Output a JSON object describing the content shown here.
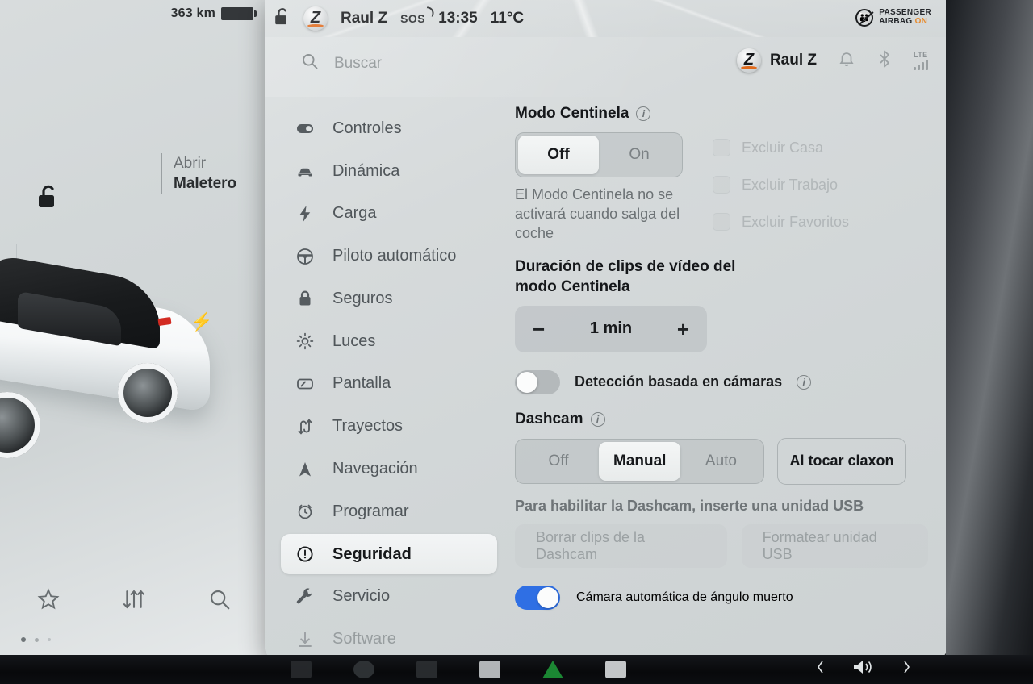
{
  "car_panel": {
    "range": "363 km",
    "battery_icon": "battery-icon",
    "lock_icon": "unlock-icon",
    "trunk_callout": {
      "action": "Abrir",
      "target": "Maletero"
    },
    "toolbar": [
      {
        "name": "favorites-icon",
        "glyph": "star"
      },
      {
        "name": "sliders-icon",
        "glyph": "sliders"
      },
      {
        "name": "search-icon",
        "glyph": "magnifier"
      }
    ]
  },
  "status_strip": {
    "lock_icon": "unlock-icon",
    "profile_name": "Raul Z",
    "sos_label": "SOS",
    "clock": "13:35",
    "temperature": "11°C",
    "airbag": {
      "line1": "PASSENGER",
      "line2": "AIRBAG",
      "state": "ON",
      "state_color": "#e8892a"
    }
  },
  "header": {
    "search_placeholder": "Buscar",
    "profile_name": "Raul Z",
    "icons": [
      "bell-icon",
      "bluetooth-icon",
      "lte-signal-icon"
    ],
    "network_label": "LTE"
  },
  "sidebar": {
    "items": [
      {
        "label": "Controles",
        "icon": "toggle-icon",
        "active": false,
        "dim": false
      },
      {
        "label": "Dinámica",
        "icon": "car-icon",
        "active": false,
        "dim": false
      },
      {
        "label": "Carga",
        "icon": "bolt-icon",
        "active": false,
        "dim": false
      },
      {
        "label": "Piloto automático",
        "icon": "steering-wheel-icon",
        "active": false,
        "dim": false
      },
      {
        "label": "Seguros",
        "icon": "lock-icon",
        "active": false,
        "dim": false
      },
      {
        "label": "Luces",
        "icon": "sun-icon",
        "active": false,
        "dim": false
      },
      {
        "label": "Pantalla",
        "icon": "display-icon",
        "active": false,
        "dim": false
      },
      {
        "label": "Trayectos",
        "icon": "routes-icon",
        "active": false,
        "dim": false
      },
      {
        "label": "Navegación",
        "icon": "navigation-arrow-icon",
        "active": false,
        "dim": false
      },
      {
        "label": "Programar",
        "icon": "schedule-clock-icon",
        "active": false,
        "dim": false
      },
      {
        "label": "Seguridad",
        "icon": "alert-circle-icon",
        "active": true,
        "dim": false
      },
      {
        "label": "Servicio",
        "icon": "wrench-icon",
        "active": false,
        "dim": false
      },
      {
        "label": "Software",
        "icon": "download-icon",
        "active": false,
        "dim": true
      }
    ]
  },
  "content": {
    "sentry": {
      "title": "Modo Centinela",
      "info_icon": "info-icon",
      "options": [
        {
          "label": "Off",
          "selected": true
        },
        {
          "label": "On",
          "selected": false
        }
      ],
      "description": "El Modo Centinela no se activará cuando salga del coche",
      "exclusions": [
        {
          "label": "Excluir Casa",
          "checked": false,
          "disabled": true
        },
        {
          "label": "Excluir Trabajo",
          "checked": false,
          "disabled": true
        },
        {
          "label": "Excluir Favoritos",
          "checked": false,
          "disabled": true
        }
      ]
    },
    "clip_duration": {
      "title": "Duración de clips de vídeo del modo Centinela",
      "decrement": "−",
      "value": "1 min",
      "increment": "+"
    },
    "camera_detection": {
      "label": "Detección basada en cámaras",
      "info_icon": "info-icon",
      "enabled": false
    },
    "dashcam": {
      "title": "Dashcam",
      "info_icon": "info-icon",
      "options": [
        {
          "label": "Off",
          "selected": false
        },
        {
          "label": "Manual",
          "selected": true
        },
        {
          "label": "Auto",
          "selected": false
        }
      ],
      "horn_button": "Al tocar claxon",
      "usb_note": "Para habilitar la Dashcam, inserte una unidad USB",
      "actions": [
        {
          "label": "Borrar clips de la Dashcam",
          "disabled": true
        },
        {
          "label": "Formatear unidad USB",
          "disabled": true
        }
      ]
    },
    "blind_spot": {
      "label": "Cámara automática de ángulo muerto",
      "enabled": true,
      "accent_color": "#2f6fe4"
    }
  },
  "taskbar": {
    "previous_icon": "chevron-left-icon",
    "volume_icon": "volume-icon",
    "next_icon": "chevron-right-icon"
  }
}
